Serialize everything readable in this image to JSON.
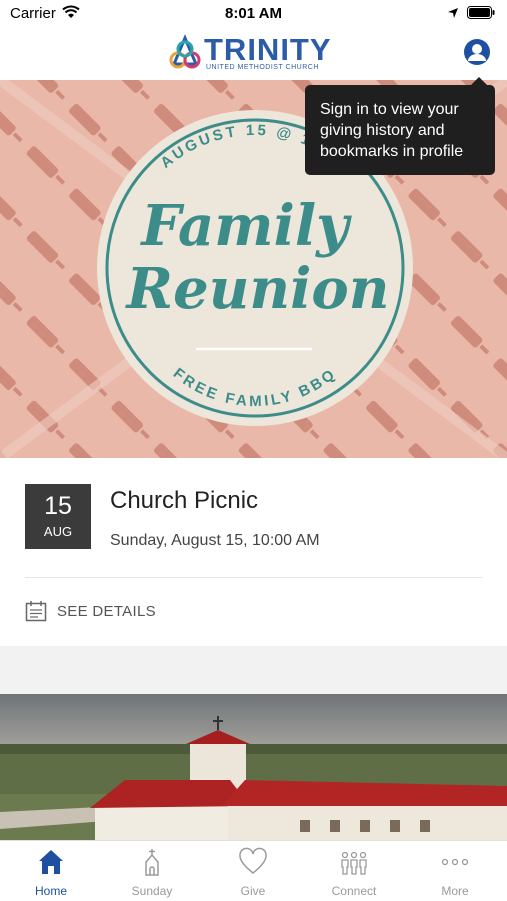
{
  "status_bar": {
    "carrier": "Carrier",
    "time": "8:01 AM"
  },
  "header": {
    "logo_word": "TRINITY",
    "logo_subtitle": "UNITED METHODIST CHURCH",
    "accent_color": "#2c5ca8"
  },
  "tooltip": {
    "text": "Sign in to view your giving history and bookmarks in profile"
  },
  "hero": {
    "top_text": "AUGUST 15 @ 10AM",
    "title_line1": "Family",
    "title_line2": "Reunion",
    "bottom_text": "FREE FAMILY BBQ"
  },
  "event": {
    "day": "15",
    "month": "AUG",
    "title": "Church Picnic",
    "datetime": "Sunday, August 15, 10:00 AM",
    "details_label": "SEE DETAILS"
  },
  "tabs": [
    {
      "label": "Home",
      "icon": "home-icon",
      "active": true
    },
    {
      "label": "Sunday",
      "icon": "church-icon",
      "active": false
    },
    {
      "label": "Give",
      "icon": "heart-icon",
      "active": false
    },
    {
      "label": "Connect",
      "icon": "people-icon",
      "active": false
    },
    {
      "label": "More",
      "icon": "more-icon",
      "active": false
    }
  ]
}
